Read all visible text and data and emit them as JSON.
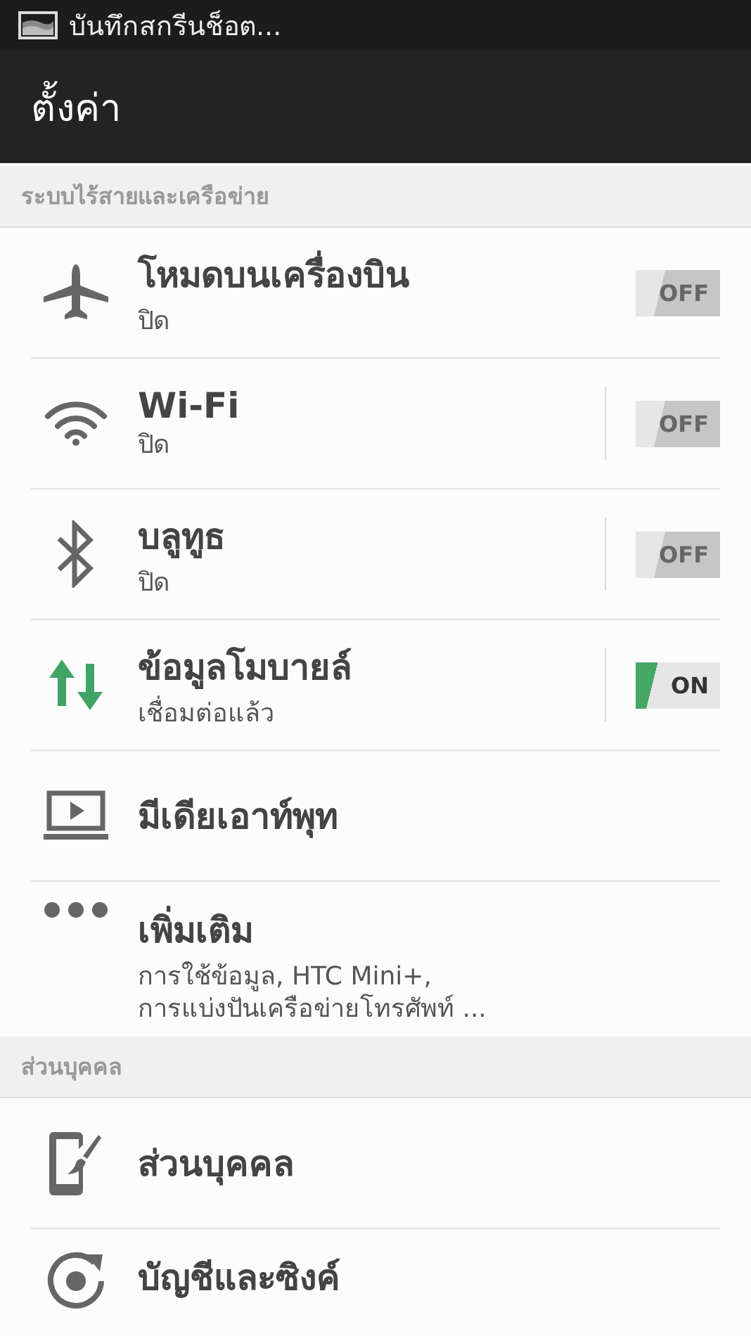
{
  "status_bar": {
    "notification": "บันทึกสกรีนช็อต..."
  },
  "action_bar": {
    "title": "ตั้งค่า"
  },
  "sections": [
    {
      "header": "ระบบไร้สายและเครือข่าย",
      "items": [
        {
          "kind": "toggle",
          "title": "โหมดบนเครื่องบิน",
          "subtitle": "ปิด",
          "split": false,
          "on": false,
          "switch_label": "OFF"
        },
        {
          "kind": "toggle",
          "title": "Wi-Fi",
          "subtitle": "ปิด",
          "split": true,
          "on": false,
          "switch_label": "OFF"
        },
        {
          "kind": "toggle",
          "title": "บลูทูธ",
          "subtitle": "ปิด",
          "split": true,
          "on": false,
          "switch_label": "OFF"
        },
        {
          "kind": "toggle",
          "title": "ข้อมูลโมบายล์",
          "subtitle": "เชื่อมต่อแล้ว",
          "split": true,
          "on": true,
          "switch_label": "ON"
        },
        {
          "kind": "link",
          "title": "มีเดียเอาท์พุท"
        },
        {
          "kind": "link",
          "title": "เพิ่มเติม",
          "subtitle": "การใช้ข้อมูล, HTC Mini+,\nการแบ่งปันเครือข่ายโทรศัพท์ ..."
        }
      ]
    },
    {
      "header": "ส่วนบุคคล",
      "items": [
        {
          "kind": "link",
          "title": "ส่วนบุคคล"
        },
        {
          "kind": "link",
          "title": "บัญชีและซิงค์"
        }
      ]
    }
  ]
}
